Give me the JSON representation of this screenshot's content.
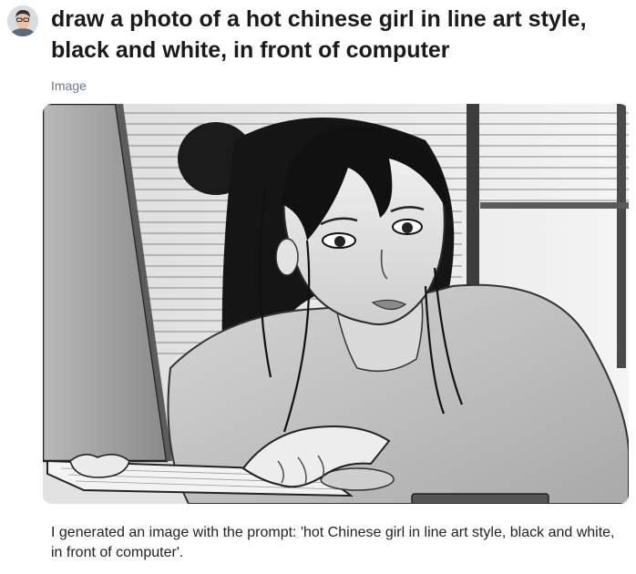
{
  "message": {
    "prompt": "draw a photo of a hot chinese girl in line art style, black and white, in front of computer",
    "media_label": "Image",
    "caption": "I generated an image with the prompt: 'hot Chinese girl in line art style, black and white, in front of computer'."
  },
  "user": {
    "avatar_icon": "user-avatar-photo"
  },
  "image": {
    "style": "grayscale line art",
    "subject_icon": "woman-at-computer-illustration"
  }
}
